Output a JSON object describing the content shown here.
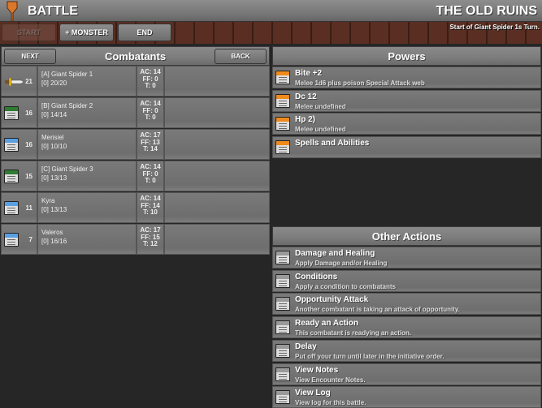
{
  "header": {
    "title": "BATTLE",
    "location": "THE OLD RUINS",
    "turn_status": "Start of Giant Spider 1s Turn."
  },
  "toolbar": {
    "start": "START",
    "monster": "+ MONSTER",
    "end": "END"
  },
  "combatants": {
    "title": "Combatants",
    "next": "NEXT",
    "back": "BACK",
    "rows": [
      {
        "icon": "sword-icon",
        "init": "21",
        "name": "[A] Giant Spider 1",
        "hp": "[0] 20/20",
        "ac": "AC: 14",
        "ff": "FF: 0",
        "t": "T: 0"
      },
      {
        "icon": "monster-card-icon",
        "init": "16",
        "name": "[B] Giant Spider 2",
        "hp": "[0] 14/14",
        "ac": "AC: 14",
        "ff": "FF: 0",
        "t": "T: 0"
      },
      {
        "icon": "character-card-icon",
        "init": "16",
        "name": "Merisiel",
        "hp": "[0] 10/10",
        "ac": "AC: 17",
        "ff": "FF: 13",
        "t": "T: 14"
      },
      {
        "icon": "monster-card-icon",
        "init": "15",
        "name": "[C] Giant Spider 3",
        "hp": "[0] 13/13",
        "ac": "AC: 14",
        "ff": "FF: 0",
        "t": "T: 0"
      },
      {
        "icon": "character-card-icon",
        "init": "11",
        "name": "Kyra",
        "hp": "[0] 13/13",
        "ac": "AC: 14",
        "ff": "FF: 14",
        "t": "T: 10"
      },
      {
        "icon": "character-card-icon",
        "init": "7",
        "name": "Valeros",
        "hp": "[0] 16/16",
        "ac": "AC: 17",
        "ff": "FF: 15",
        "t": "T: 12"
      }
    ]
  },
  "powers": {
    "title": "Powers",
    "items": [
      {
        "title": "Bite +2",
        "sub": "Melee 1d6 plus poison Special Attack web"
      },
      {
        "title": " Dc 12",
        "sub": "Melee undefined"
      },
      {
        "title": " Hp 2)",
        "sub": "Melee undefined"
      },
      {
        "title": "Spells and Abilities",
        "sub": ""
      }
    ]
  },
  "other_actions": {
    "title": "Other Actions",
    "items": [
      {
        "title": "Damage and Healing",
        "sub": "Apply Damage and/or Healing"
      },
      {
        "title": "Conditions",
        "sub": "Apply a condition to combatants"
      },
      {
        "title": "Opportunity Attack",
        "sub": "Another combatant is taking an attack of opportunity."
      },
      {
        "title": "Ready an Action",
        "sub": "This combatant is readying an action."
      },
      {
        "title": "Delay",
        "sub": "Put off your turn until later in the initiative order."
      },
      {
        "title": "View Notes",
        "sub": "View Encounter Notes."
      },
      {
        "title": "View Log",
        "sub": "View log for this battle."
      }
    ]
  },
  "colors": {
    "monster": "#2e7d32",
    "character": "#5aa0e0",
    "power": "#f08a1c",
    "action": "#9a9a9a"
  }
}
